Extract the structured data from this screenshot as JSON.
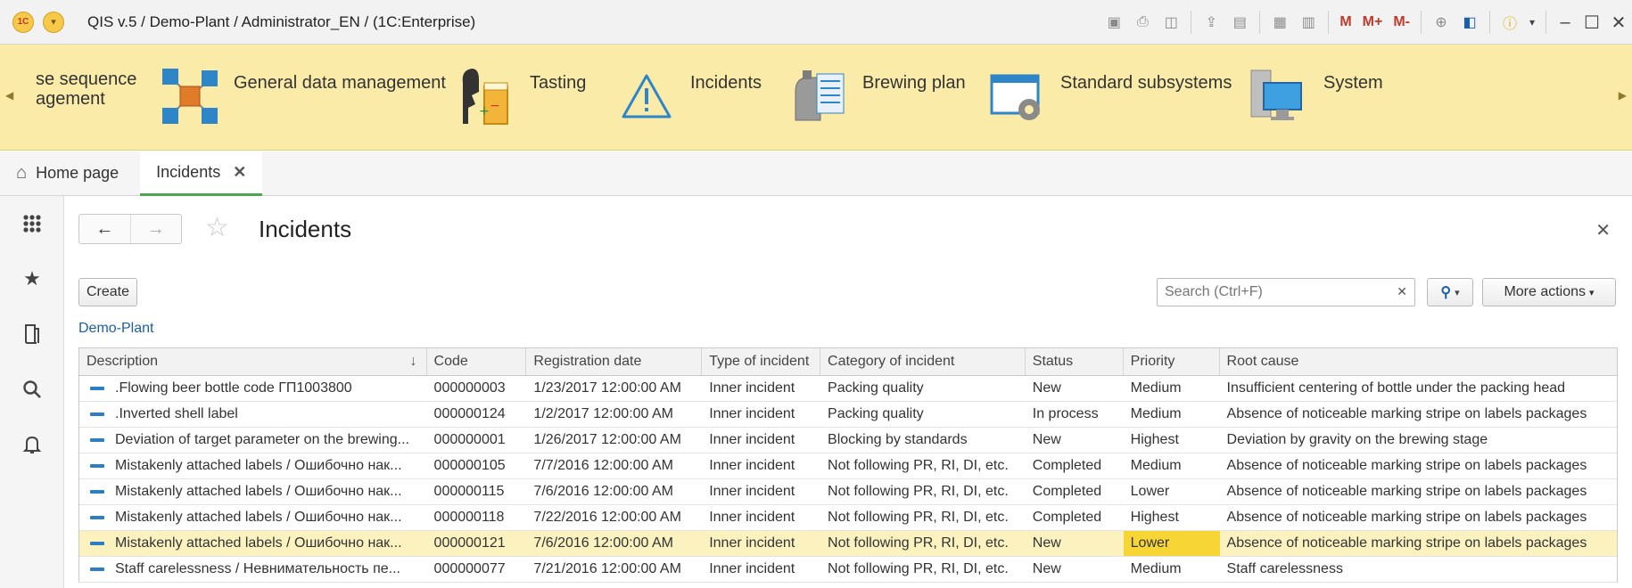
{
  "titlebar": {
    "logo": "1C",
    "title": "QIS v.5 / Demo-Plant / Administrator_EN /  (1C:Enterprise)",
    "tools": [
      "save-icon",
      "print-icon",
      "preview-icon",
      "upload-icon",
      "scan-icon",
      "calculator-icon",
      "calendar-icon"
    ],
    "m_labels": [
      "M",
      "M+",
      "M-"
    ],
    "window": {
      "minimize": "–",
      "maximize": "☐",
      "close": "✕"
    }
  },
  "sections": [
    {
      "label": "se sequence\nagement",
      "icon": "sequence-icon"
    },
    {
      "label": "General data management",
      "icon": "cubes-icon"
    },
    {
      "label": "Tasting",
      "icon": "tasting-icon"
    },
    {
      "label": "Incidents",
      "icon": "warning-icon"
    },
    {
      "label": "Brewing plan",
      "icon": "brewing-tank-icon"
    },
    {
      "label": "Standard subsystems",
      "icon": "settings-window-icon"
    },
    {
      "label": "System",
      "icon": "computer-icon"
    }
  ],
  "tabs": {
    "home": "Home page",
    "active": "Incidents"
  },
  "page": {
    "title": "Incidents",
    "create": "Create",
    "search_placeholder": "Search (Ctrl+F)",
    "more_actions": "More actions",
    "org_link": "Demo-Plant"
  },
  "table": {
    "columns": [
      "Description",
      "Code",
      "Registration date",
      "Type of incident",
      "Category of incident",
      "Status",
      "Priority",
      "Root cause"
    ],
    "rows": [
      {
        "desc": ".Flowing beer bottle code ГП1003800",
        "code": "000000003",
        "date": "1/23/2017 12:00:00 AM",
        "type": "Inner incident",
        "category": "Packing quality",
        "status": "New",
        "priority": "Medium",
        "cause": "Insufficient centering of bottle under the packing head"
      },
      {
        "desc": ".Inverted shell label",
        "code": "000000124",
        "date": "1/2/2017 12:00:00 AM",
        "type": "Inner incident",
        "category": "Packing quality",
        "status": "In process",
        "priority": "Medium",
        "cause": "Absence of noticeable marking stripe on labels packages"
      },
      {
        "desc": "Deviation of target parameter on the brewing...",
        "code": "000000001",
        "date": "1/26/2017 12:00:00 AM",
        "type": "Inner incident",
        "category": "Blocking by standards",
        "status": "New",
        "priority": "Highest",
        "cause": "Deviation by gravity on the brewing stage"
      },
      {
        "desc": "Mistakenly attached labels / Ошибочно нак...",
        "code": "000000105",
        "date": "7/7/2016 12:00:00 AM",
        "type": "Inner incident",
        "category": "Not following PR, RI, DI, etc.",
        "status": "Completed",
        "priority": "Medium",
        "cause": "Absence of noticeable marking stripe on labels packages"
      },
      {
        "desc": "Mistakenly attached labels / Ошибочно нак...",
        "code": "000000115",
        "date": "7/6/2016 12:00:00 AM",
        "type": "Inner incident",
        "category": "Not following PR, RI, DI, etc.",
        "status": "Completed",
        "priority": "Lower",
        "cause": "Absence of noticeable marking stripe on labels packages"
      },
      {
        "desc": "Mistakenly attached labels / Ошибочно нак...",
        "code": "000000118",
        "date": "7/22/2016 12:00:00 AM",
        "type": "Inner incident",
        "category": "Not following PR, RI, DI, etc.",
        "status": "Completed",
        "priority": "Highest",
        "cause": "Absence of noticeable marking stripe on labels packages"
      },
      {
        "desc": "Mistakenly attached labels / Ошибочно нак...",
        "code": "000000121",
        "date": "7/6/2016 12:00:00 AM",
        "type": "Inner incident",
        "category": "Not following PR, RI, DI, etc.",
        "status": "New",
        "priority": "Lower",
        "cause": "Absence of noticeable marking stripe on labels packages",
        "selected": true
      },
      {
        "desc": "Staff carelessness / Невнимательность пе...",
        "code": "000000077",
        "date": "7/21/2016 12:00:00 AM",
        "type": "Inner incident",
        "category": "Not following PR, RI, DI, etc.",
        "status": "New",
        "priority": "Medium",
        "cause": "Staff carelessness"
      }
    ]
  },
  "colors": {
    "sections_bg": "#fbeba8",
    "selected_row": "#fbf2c0",
    "priority_highlight": "#f6d535",
    "link": "#1b5fa8"
  }
}
